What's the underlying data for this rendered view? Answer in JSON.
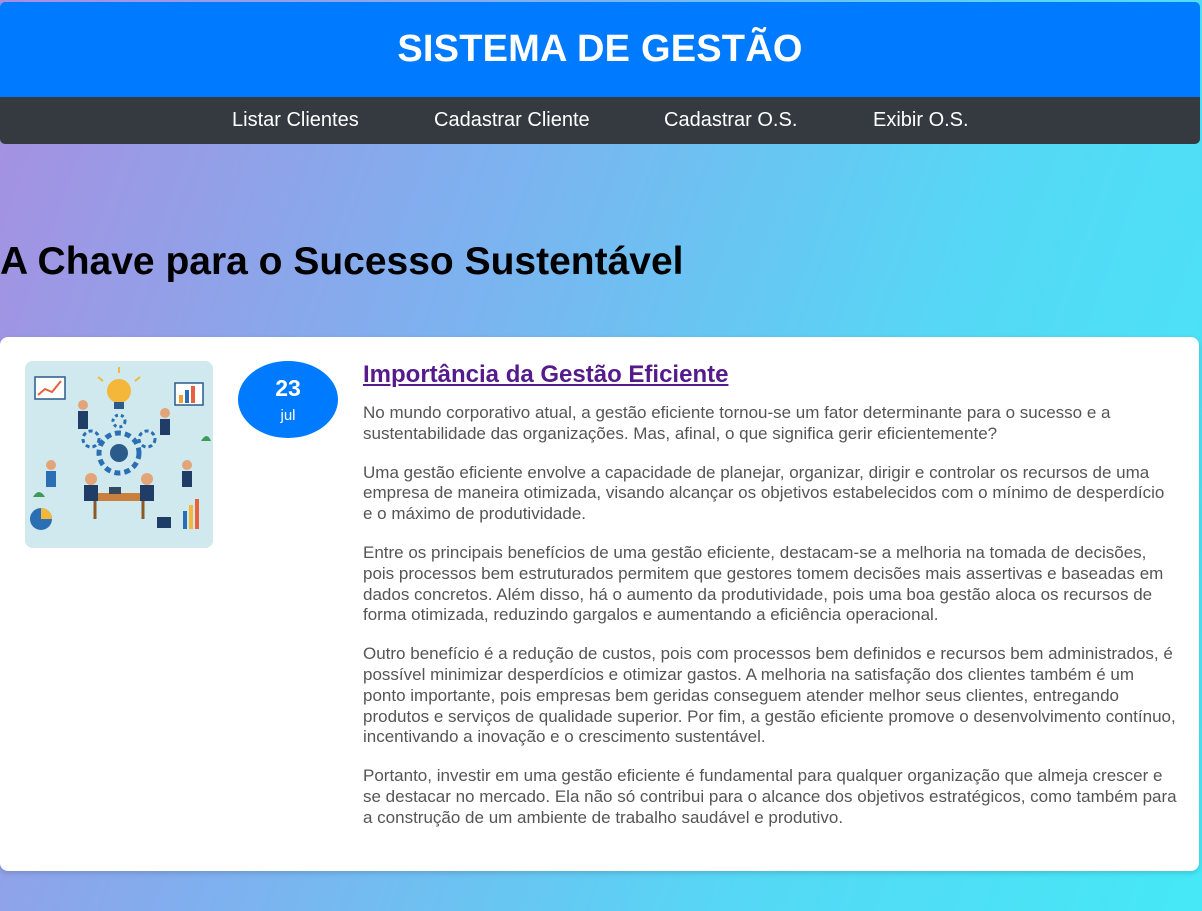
{
  "header": {
    "title": "SISTEMA DE GESTÃO"
  },
  "nav": {
    "items": [
      {
        "label": "Listar Clientes"
      },
      {
        "label": "Cadastrar Cliente"
      },
      {
        "label": "Cadastrar O.S."
      },
      {
        "label": "Exibir O.S."
      }
    ]
  },
  "main": {
    "heading": "A Chave para o Sucesso Sustentável"
  },
  "post": {
    "image_icon": "business-management-illustration",
    "date": {
      "day": "23",
      "month": "jul"
    },
    "title": "Importância da Gestão Eficiente",
    "paragraphs": [
      "No mundo corporativo atual, a gestão eficiente tornou-se um fator determinante para o sucesso e a sustentabilidade das organizações. Mas, afinal, o que significa gerir eficientemente?",
      "Uma gestão eficiente envolve a capacidade de planejar, organizar, dirigir e controlar os recursos de uma empresa de maneira otimizada, visando alcançar os objetivos estabelecidos com o mínimo de desperdício e o máximo de produtividade.",
      "Entre os principais benefícios de uma gestão eficiente, destacam-se a melhoria na tomada de decisões, pois processos bem estruturados permitem que gestores tomem decisões mais assertivas e baseadas em dados concretos. Além disso, há o aumento da produtividade, pois uma boa gestão aloca os recursos de forma otimizada, reduzindo gargalos e aumentando a eficiência operacional.",
      "Outro benefício é a redução de custos, pois com processos bem definidos e recursos bem administrados, é possível minimizar desperdícios e otimizar gastos. A melhoria na satisfação dos clientes também é um ponto importante, pois empresas bem geridas conseguem atender melhor seus clientes, entregando produtos e serviços de qualidade superior. Por fim, a gestão eficiente promove o desenvolvimento contínuo, incentivando a inovação e o crescimento sustentável.",
      "Portanto, investir em uma gestão eficiente é fundamental para qualquer organização que almeja crescer e se destacar no mercado. Ela não só contribui para o alcance dos objetivos estratégicos, como também para a construção de um ambiente de trabalho saudável e produtivo."
    ]
  },
  "colors": {
    "header_bg": "#007bff",
    "nav_bg": "#343a40",
    "badge_bg": "#007bff",
    "title_link": "#551a8b",
    "body_text": "#555555"
  }
}
